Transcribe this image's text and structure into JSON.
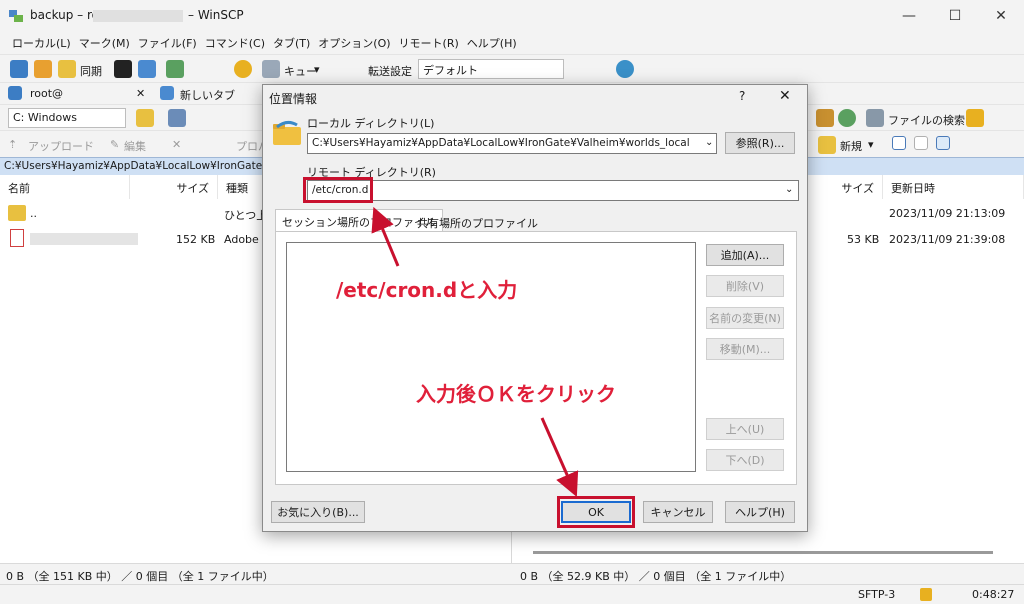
{
  "window": {
    "title_prefix": "backup – root@",
    "title_suffix": "– WinSCP",
    "minimize": "—",
    "maximize": "☐",
    "close": "✕"
  },
  "menu": [
    "ローカル(L)",
    "マーク(M)",
    "ファイル(F)",
    "コマンド(C)",
    "タブ(T)",
    "オプション(O)",
    "リモート(R)",
    "ヘルプ(H)"
  ],
  "toolbar1": {
    "sync_label": "同期",
    "queue_label": "キュー",
    "transfer_label": "転送設定",
    "transfer_value": "デフォルト"
  },
  "tabs": {
    "session_tab": "root@",
    "new_tab": "新しいタブ"
  },
  "left_toolbar": {
    "drive": "C: Windows",
    "upload": "アップロード",
    "edit": "編集",
    "props": "プロパ"
  },
  "right_toolbar": {
    "search": "ファイルの検索",
    "new": "新規"
  },
  "left_path": "C:¥Users¥Hayamiz¥AppData¥LocalLow¥IronGate¥V",
  "left_panel": {
    "headers": [
      "名前",
      "サイズ",
      "種類"
    ],
    "rows": [
      {
        "name": "..",
        "size": "",
        "type": "ひとつ上"
      },
      {
        "name": "",
        "size": "152 KB",
        "type": "Adobe"
      }
    ]
  },
  "right_panel": {
    "headers": [
      "サイズ",
      "更新日時"
    ],
    "rows": [
      {
        "size": "",
        "date": "2023/11/09 21:13:09"
      },
      {
        "size": "53 KB",
        "date": "2023/11/09 21:39:08"
      }
    ]
  },
  "status": {
    "left": "0 B （全 151 KB 中） ／ 0 個目 （全 1 ファイル中）",
    "right": "0 B （全 52.9 KB 中） ／ 0 個目 （全 1 ファイル中）",
    "protocol": "SFTP-3",
    "time": "0:48:27"
  },
  "dialog": {
    "title": "位置情報",
    "help": "?",
    "close": "✕",
    "local_label": "ローカル ディレクトリ(L)",
    "local_value": "C:¥Users¥Hayamiz¥AppData¥LocalLow¥IronGate¥Valheim¥worlds_local",
    "browse": "参照(R)...",
    "remote_label": "リモート ディレクトリ(R)",
    "remote_value": "/etc/cron.d",
    "tab_session": "セッション場所のプロファイル",
    "tab_shared": "共有場所のプロファイル",
    "side_buttons": [
      "追加(A)...",
      "削除(V)",
      "名前の変更(N)",
      "移動(M)...",
      "上へ(U)",
      "下へ(D)"
    ],
    "favorites": "お気に入り(B)...",
    "ok": "OK",
    "cancel": "キャンセル",
    "helpbtn": "ヘルプ(H)"
  },
  "annotations": {
    "a1": "/etc/cron.dと入力",
    "a2": "入力後ＯＫをクリック"
  },
  "colors": {
    "annotation_red": "#e0203a",
    "path_blue": "#cfe0f4"
  }
}
